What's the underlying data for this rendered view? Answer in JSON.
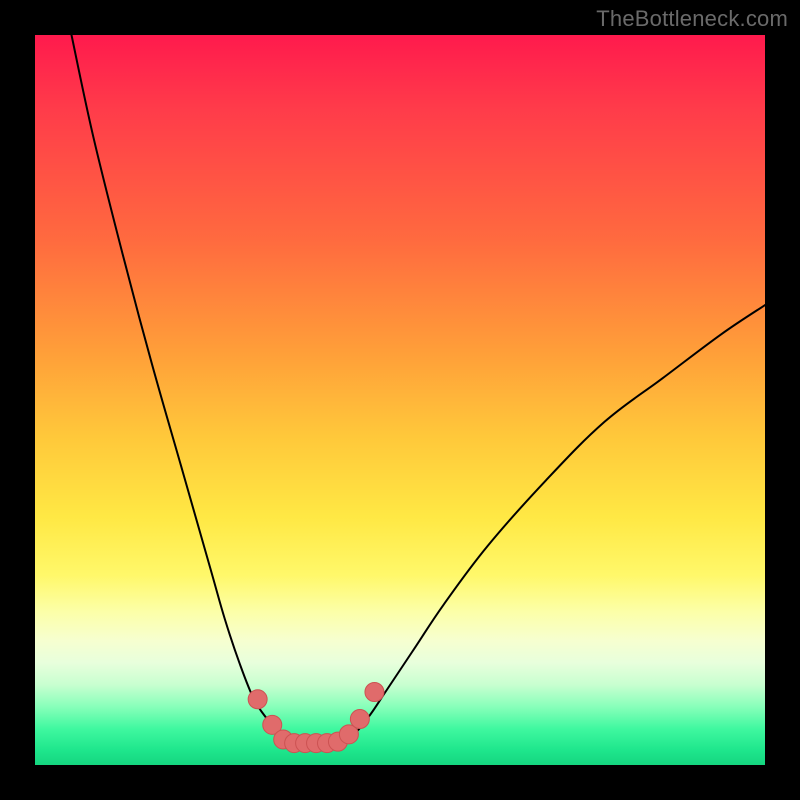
{
  "watermark": "TheBottleneck.com",
  "colors": {
    "frame": "#000000",
    "curve": "#000000",
    "marker_fill": "#e06b6b",
    "marker_stroke": "#cc5252",
    "gradient_stops": [
      "#ff1a4d",
      "#ff6a3f",
      "#ffc83a",
      "#fff86a",
      "#f6ffd0",
      "#40f8a0",
      "#15d680"
    ]
  },
  "chart_data": {
    "type": "line",
    "title": "",
    "xlabel": "",
    "ylabel": "",
    "xlim": [
      0,
      100
    ],
    "ylim": [
      0,
      100
    ],
    "grid": false,
    "legend": false,
    "series": [
      {
        "name": "left-curve",
        "x": [
          5,
          8,
          12,
          16,
          20,
          24,
          26,
          28,
          30,
          32,
          33,
          34,
          35
        ],
        "y": [
          100,
          86,
          70,
          55,
          41,
          27,
          20,
          14,
          9,
          6,
          4.5,
          3.5,
          3
        ]
      },
      {
        "name": "right-curve",
        "x": [
          42,
          44,
          46,
          48,
          52,
          56,
          62,
          70,
          78,
          86,
          94,
          100
        ],
        "y": [
          3,
          4.5,
          7,
          10,
          16,
          22,
          30,
          39,
          47,
          53,
          59,
          63
        ]
      },
      {
        "name": "markers",
        "x": [
          30.5,
          32.5,
          34,
          35.5,
          37,
          38.5,
          40,
          41.5,
          43,
          44.5,
          46.5
        ],
        "y": [
          9,
          5.5,
          3.5,
          3,
          3,
          3,
          3,
          3.2,
          4.2,
          6.3,
          10
        ]
      }
    ]
  }
}
